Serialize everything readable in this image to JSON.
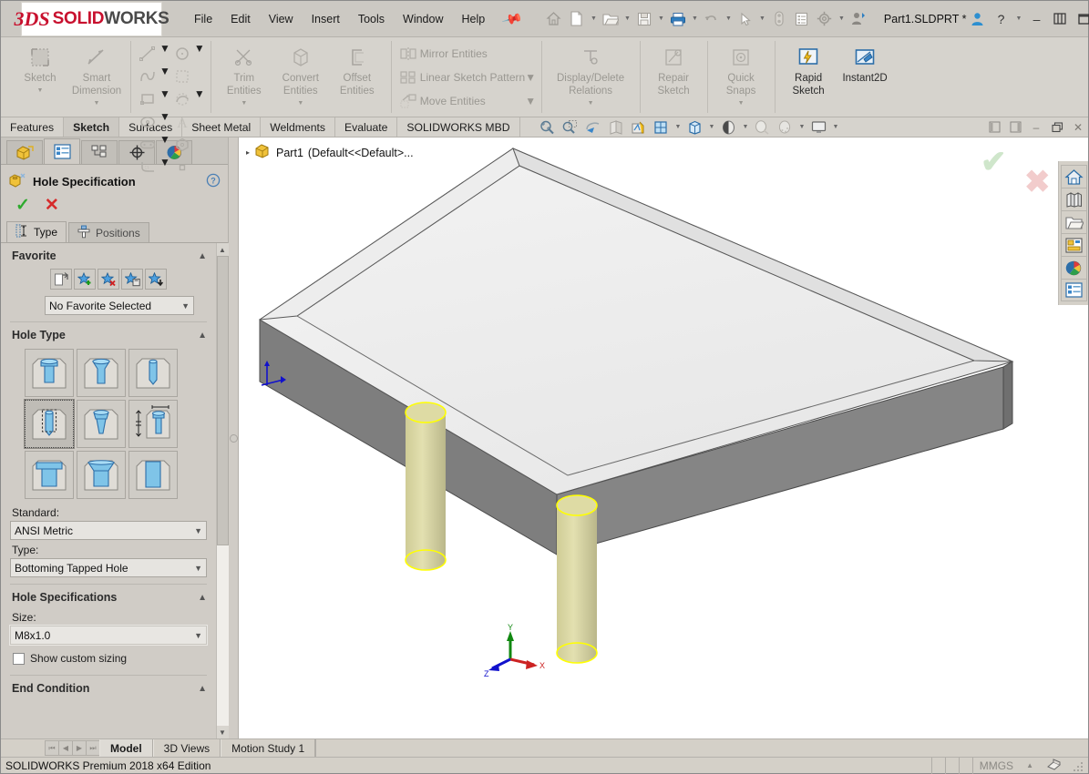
{
  "app": {
    "brand_ds": "3DS",
    "brand_solid": "SOLID",
    "brand_works": "WORKS",
    "document_title": "Part1.SLDPRT *",
    "accent_red": "#c8102e",
    "accent_blue": "#1f72c4"
  },
  "menu": {
    "items": [
      {
        "label": "File"
      },
      {
        "label": "Edit"
      },
      {
        "label": "View"
      },
      {
        "label": "Insert"
      },
      {
        "label": "Tools"
      },
      {
        "label": "Window"
      },
      {
        "label": "Help"
      }
    ],
    "pin_icon": "pushpin-icon"
  },
  "quick_access": {
    "buttons": [
      {
        "name": "home-icon",
        "label": "Home"
      },
      {
        "name": "new-document-icon",
        "label": "New"
      },
      {
        "name": "open-folder-icon",
        "label": "Open"
      },
      {
        "name": "save-icon",
        "label": "Save"
      },
      {
        "name": "print-icon",
        "label": "Print"
      },
      {
        "name": "undo-icon",
        "label": "Undo"
      },
      {
        "name": "select-cursor-icon",
        "label": "Select"
      },
      {
        "name": "rebuild-icon",
        "label": "Rebuild"
      },
      {
        "name": "file-properties-icon",
        "label": "File Properties"
      },
      {
        "name": "options-gear-icon",
        "label": "Options"
      },
      {
        "name": "user-profile-icon",
        "label": "User"
      }
    ]
  },
  "window_controls": {
    "account_icon": "account-icon",
    "help_label": "?",
    "minimize_label": "–",
    "restore_label": "❐",
    "close_label": "✕"
  },
  "ribbon": {
    "groups": [
      {
        "name": "sketch-group",
        "big": [
          {
            "label_line1": "Sketch",
            "label_line2": "",
            "icon": "sketch-icon",
            "enabled": false,
            "dropdown": true
          },
          {
            "label_line1": "Smart",
            "label_line2": "Dimension",
            "icon": "smart-dimension-icon",
            "enabled": false,
            "dropdown": true
          }
        ]
      },
      {
        "name": "entities-group",
        "mini": [
          {
            "icon": "line-icon",
            "dropdown": true
          },
          {
            "icon": "circle-icon",
            "dropdown": true
          },
          {
            "icon": "spline-icon",
            "dropdown": true
          },
          {
            "icon": "select-box-icon",
            "dropdown": false
          },
          {
            "icon": "rectangle-icon",
            "dropdown": true
          },
          {
            "icon": "polygon-arc-icon",
            "dropdown": true
          },
          {
            "icon": "ellipse-icon",
            "dropdown": true
          },
          {
            "icon": "text-a-icon",
            "dropdown": false
          },
          {
            "icon": "slot-icon",
            "dropdown": true
          },
          {
            "icon": "hexagon-icon",
            "dropdown": false
          },
          {
            "icon": "fillet-icon",
            "dropdown": true
          },
          {
            "icon": "point-icon",
            "dropdown": false
          }
        ]
      },
      {
        "name": "trim-convert-group",
        "big": [
          {
            "label_line1": "Trim",
            "label_line2": "Entities",
            "icon": "trim-entities-icon",
            "enabled": false,
            "dropdown": true
          },
          {
            "label_line1": "Convert",
            "label_line2": "Entities",
            "icon": "convert-entities-icon",
            "enabled": false,
            "dropdown": true
          },
          {
            "label_line1": "Offset",
            "label_line2": "Entities",
            "icon": "offset-entities-icon",
            "enabled": false,
            "dropdown": false
          }
        ]
      },
      {
        "name": "pattern-group",
        "list": [
          {
            "label": "Mirror Entities",
            "icon": "mirror-entities-icon"
          },
          {
            "label": "Linear Sketch Pattern",
            "icon": "linear-sketch-pattern-icon",
            "dropdown": true
          },
          {
            "label": "Move Entities",
            "icon": "move-entities-icon",
            "dropdown": true
          }
        ]
      },
      {
        "name": "relations-group",
        "big": [
          {
            "label_line1": "Display/Delete",
            "label_line2": "Relations",
            "icon": "display-delete-relations-icon",
            "enabled": false,
            "dropdown": true
          }
        ]
      },
      {
        "name": "repair-group",
        "big": [
          {
            "label_line1": "Repair",
            "label_line2": "Sketch",
            "icon": "repair-sketch-icon",
            "enabled": false,
            "dropdown": false
          }
        ]
      },
      {
        "name": "snaps-group",
        "big": [
          {
            "label_line1": "Quick",
            "label_line2": "Snaps",
            "icon": "quick-snaps-icon",
            "enabled": false,
            "dropdown": true
          }
        ]
      },
      {
        "name": "rapid-group",
        "big": [
          {
            "label_line1": "Rapid",
            "label_line2": "Sketch",
            "icon": "rapid-sketch-icon",
            "enabled": true,
            "dropdown": false
          },
          {
            "label_line1": "Instant2D",
            "label_line2": "",
            "icon": "instant2d-icon",
            "enabled": true,
            "dropdown": false
          }
        ]
      }
    ]
  },
  "command_tabs": {
    "items": [
      {
        "label": "Features",
        "active": false
      },
      {
        "label": "Sketch",
        "active": true
      },
      {
        "label": "Surfaces",
        "active": false
      },
      {
        "label": "Sheet Metal",
        "active": false
      },
      {
        "label": "Weldments",
        "active": false
      },
      {
        "label": "Evaluate",
        "active": false
      },
      {
        "label": "SOLIDWORKS MBD",
        "active": false
      }
    ]
  },
  "view_toolbar": {
    "buttons": [
      {
        "name": "zoom-to-fit-icon",
        "label": "Zoom to Fit",
        "dropdown": false
      },
      {
        "name": "zoom-to-area-icon",
        "label": "Zoom to Area",
        "dropdown": false
      },
      {
        "name": "previous-view-icon",
        "label": "Previous View",
        "dropdown": false
      },
      {
        "name": "section-view-icon",
        "label": "Section View",
        "dropdown": false
      },
      {
        "name": "view-orientation-icon",
        "label": "View Orientation",
        "dropdown": false
      },
      {
        "name": "display-style-icon",
        "label": "Display Style",
        "dropdown": true
      },
      {
        "name": "hide-show-items-icon",
        "label": "Hide/Show Items",
        "dropdown": true
      },
      {
        "name": "edit-appearance-icon",
        "label": "Edit Appearance",
        "dropdown": true
      },
      {
        "name": "apply-scene-icon",
        "label": "Apply Scene",
        "dropdown": false
      },
      {
        "name": "view-settings-icon",
        "label": "View Settings",
        "dropdown": true
      },
      {
        "name": "display-monitor-icon",
        "label": "Viewport",
        "dropdown": true
      }
    ],
    "window_buttons": [
      {
        "name": "tile-left-icon",
        "label": "◁"
      },
      {
        "name": "tile-right-icon",
        "label": "▷"
      },
      {
        "name": "minimize-doc-icon",
        "label": "–"
      },
      {
        "name": "restore-doc-icon",
        "label": "❐"
      },
      {
        "name": "close-doc-icon",
        "label": "✕"
      }
    ]
  },
  "property_manager": {
    "tabs": [
      {
        "name": "feature-manager-tab",
        "icon": "feature-tree-icon",
        "active": false
      },
      {
        "name": "property-manager-tab",
        "icon": "property-list-icon",
        "active": true
      },
      {
        "name": "configuration-manager-tab",
        "icon": "configuration-icon",
        "active": false
      },
      {
        "name": "dimxpert-manager-tab",
        "icon": "dimxpert-target-icon",
        "active": false
      },
      {
        "name": "display-manager-tab",
        "icon": "display-palette-icon",
        "active": false
      }
    ],
    "title": "Hole Specification",
    "title_icon": "hole-wizard-icon",
    "help_icon": "help-question-icon",
    "ok_label": "✓",
    "cancel_label": "✕",
    "sub_tabs": [
      {
        "label": "Type",
        "icon": "hole-type-icon",
        "active": true
      },
      {
        "label": "Positions",
        "icon": "hole-positions-icon",
        "active": false
      }
    ],
    "favorite": {
      "header": "Favorite",
      "buttons": [
        {
          "name": "apply-defaults-favorite-button",
          "icon": "apply-defaults-icon"
        },
        {
          "name": "add-favorite-button",
          "icon": "star-add-icon"
        },
        {
          "name": "delete-favorite-button",
          "icon": "star-delete-icon"
        },
        {
          "name": "save-favorite-button",
          "icon": "star-save-icon"
        },
        {
          "name": "load-favorite-button",
          "icon": "star-load-icon"
        }
      ],
      "selected": "No Favorite Selected"
    },
    "hole_type": {
      "header": "Hole Type",
      "cells": [
        {
          "name": "counterbore-icon",
          "label": "Counterbore",
          "selected": false
        },
        {
          "name": "countersink-icon",
          "label": "Countersink",
          "selected": false
        },
        {
          "name": "hole-icon",
          "label": "Hole",
          "selected": false
        },
        {
          "name": "straight-tap-icon",
          "label": "Straight Tap",
          "selected": true
        },
        {
          "name": "tapered-tap-icon",
          "label": "Tapered Tap",
          "selected": false
        },
        {
          "name": "legacy-hole-icon",
          "label": "Legacy Hole",
          "selected": false
        },
        {
          "name": "counterbore-slot-icon",
          "label": "Counterbore Slot",
          "selected": false
        },
        {
          "name": "countersink-slot-icon",
          "label": "Countersink Slot",
          "selected": false
        },
        {
          "name": "slot-icon",
          "label": "Slot",
          "selected": false
        }
      ],
      "standard_label": "Standard:",
      "standard_value": "ANSI Metric",
      "type_label": "Type:",
      "type_value": "Bottoming Tapped Hole"
    },
    "hole_specifications": {
      "header": "Hole Specifications",
      "size_label": "Size:",
      "size_value": "M8x1.0",
      "show_custom_sizing_label": "Show custom sizing",
      "show_custom_sizing_checked": false
    },
    "end_condition": {
      "header": "End Condition"
    }
  },
  "feature_tree": {
    "root_label": "Part1",
    "root_suffix": "(Default<<Default>...",
    "icon": "part-icon",
    "expander": "▸"
  },
  "confirmation_corner": {
    "ok_label": "✔",
    "cancel_label": "✖"
  },
  "task_pane": {
    "buttons": [
      {
        "name": "solidworks-resources-icon",
        "label": "SOLIDWORKS Resources"
      },
      {
        "name": "design-library-icon",
        "label": "Design Library"
      },
      {
        "name": "file-explorer-icon",
        "label": "File Explorer"
      },
      {
        "name": "view-palette-icon",
        "label": "View Palette"
      },
      {
        "name": "appearances-scenes-icon",
        "label": "Appearances, Scenes and Decals"
      },
      {
        "name": "custom-properties-icon",
        "label": "Custom Properties"
      }
    ]
  },
  "model": {
    "description": "Rectangular tray part with two yellow tapped-hole preview cylinders",
    "body_top_color": "#ebebeb",
    "body_inner_color": "#f0f0f0",
    "body_side_color": "#808080",
    "hole_preview_color": "#dcd9a0",
    "hole_outline_color": "#ffff00",
    "origin_label": "origin"
  },
  "triad": {
    "x_label": "X",
    "y_label": "Y",
    "z_label": "Z",
    "x_color": "#cc2222",
    "y_color": "#118811",
    "z_color": "#1111cc"
  },
  "bottom_tabs": {
    "nav": [
      "⏮",
      "◀",
      "▶",
      "⏭"
    ],
    "items": [
      {
        "label": "Model",
        "active": true
      },
      {
        "label": "3D Views",
        "active": false
      },
      {
        "label": "Motion Study 1",
        "active": false
      }
    ]
  },
  "status_bar": {
    "message": "SOLIDWORKS Premium 2018 x64 Edition",
    "units": "MMGS",
    "units_caret": "▲",
    "overlay_icon": "overlay-icon"
  }
}
